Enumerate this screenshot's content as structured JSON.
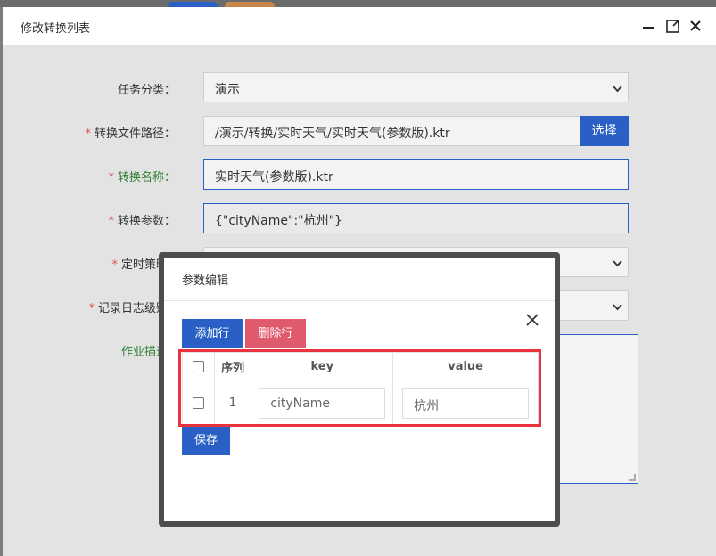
{
  "dialog": {
    "title": "修改转换列表"
  },
  "form": {
    "category": {
      "label": "任务分类：",
      "value": "演示"
    },
    "path": {
      "label": "转换文件路径：",
      "value": "/演示/转换/实时天气/实时天气(参数版).ktr",
      "button": "选择"
    },
    "name": {
      "label": "转换名称：",
      "value": "实时天气(参数版).ktr"
    },
    "params": {
      "label": "转换参数：",
      "value": "{\"cityName\":\"杭州\"}"
    },
    "schedule": {
      "label": "定时策略"
    },
    "log_level": {
      "label": "记录日志级别"
    },
    "description": {
      "label": "作业描述"
    }
  },
  "modal": {
    "title": "参数编辑",
    "add_row": "添加行",
    "delete_row": "删除行",
    "save": "保存",
    "table": {
      "headers": [
        "序列",
        "key",
        "value"
      ],
      "rows": [
        {
          "index": "1",
          "key": "cityName",
          "value": "杭州"
        }
      ]
    }
  },
  "colors": {
    "primary": "#2a60c6",
    "danger": "#e05a6e",
    "highlight": "#e8333f",
    "required": "#d9534f"
  }
}
